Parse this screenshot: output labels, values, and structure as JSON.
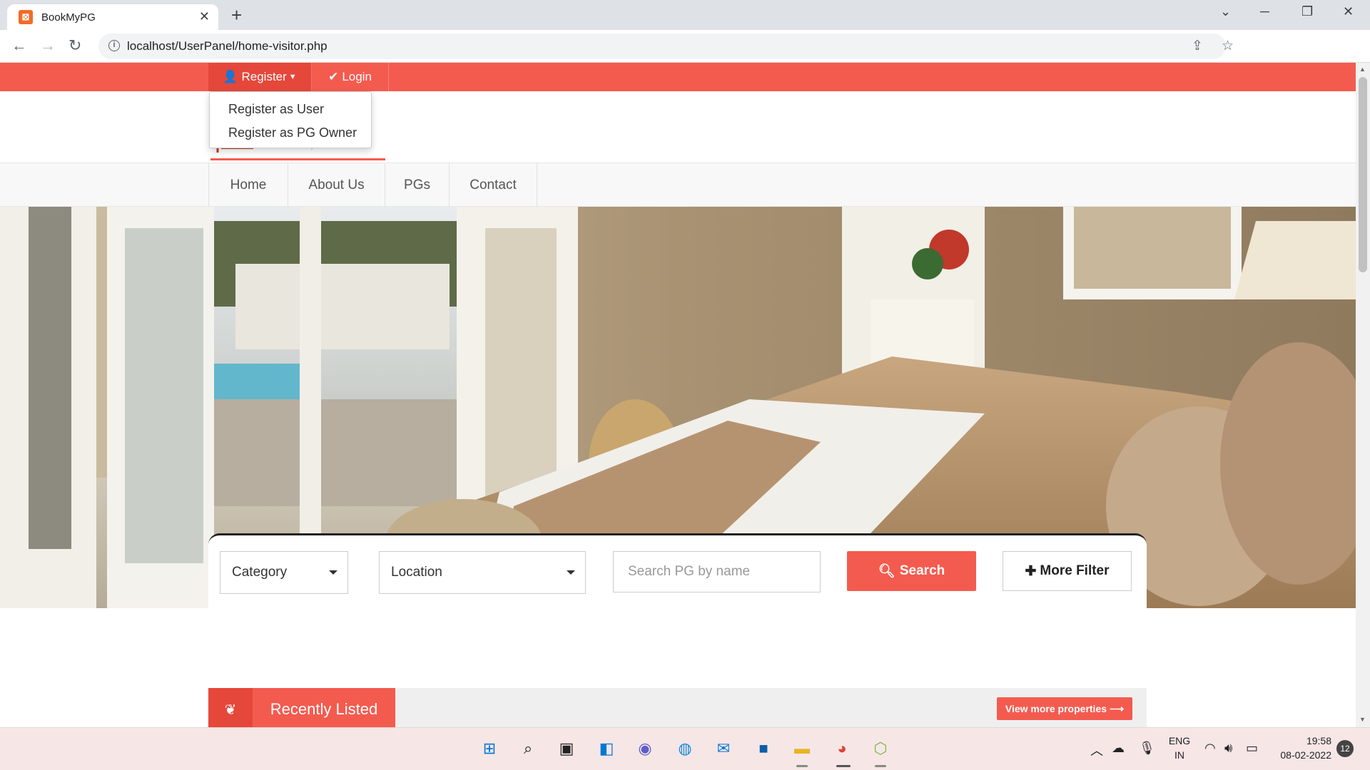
{
  "browser": {
    "tab_title": "BookMyPG",
    "tab_close": "✕",
    "new_tab": "+",
    "url": "localhost/UserPanel/home-visitor.php",
    "omnibox_info_icon": "info-icon"
  },
  "topbar": {
    "register_label": "Register",
    "login_label": "Login",
    "color": "#f45b4f"
  },
  "register_dropdown": {
    "items": [
      "Register as User",
      "Register as PG Owner"
    ]
  },
  "mainnav": {
    "items": [
      "Home",
      "About Us",
      "PGs",
      "Contact"
    ]
  },
  "search": {
    "category_value": "Category",
    "location_value": "Location",
    "name_placeholder": "Search PG by name",
    "search_button": "Search",
    "more_filter_button": "More Filter"
  },
  "recently_listed": {
    "title": "Recently Listed",
    "view_more": "View more properties"
  },
  "taskbar": {
    "lang_top": "ENG",
    "lang_bottom": "IN",
    "time": "19:58",
    "date": "08-02-2022",
    "notifications": "12"
  }
}
